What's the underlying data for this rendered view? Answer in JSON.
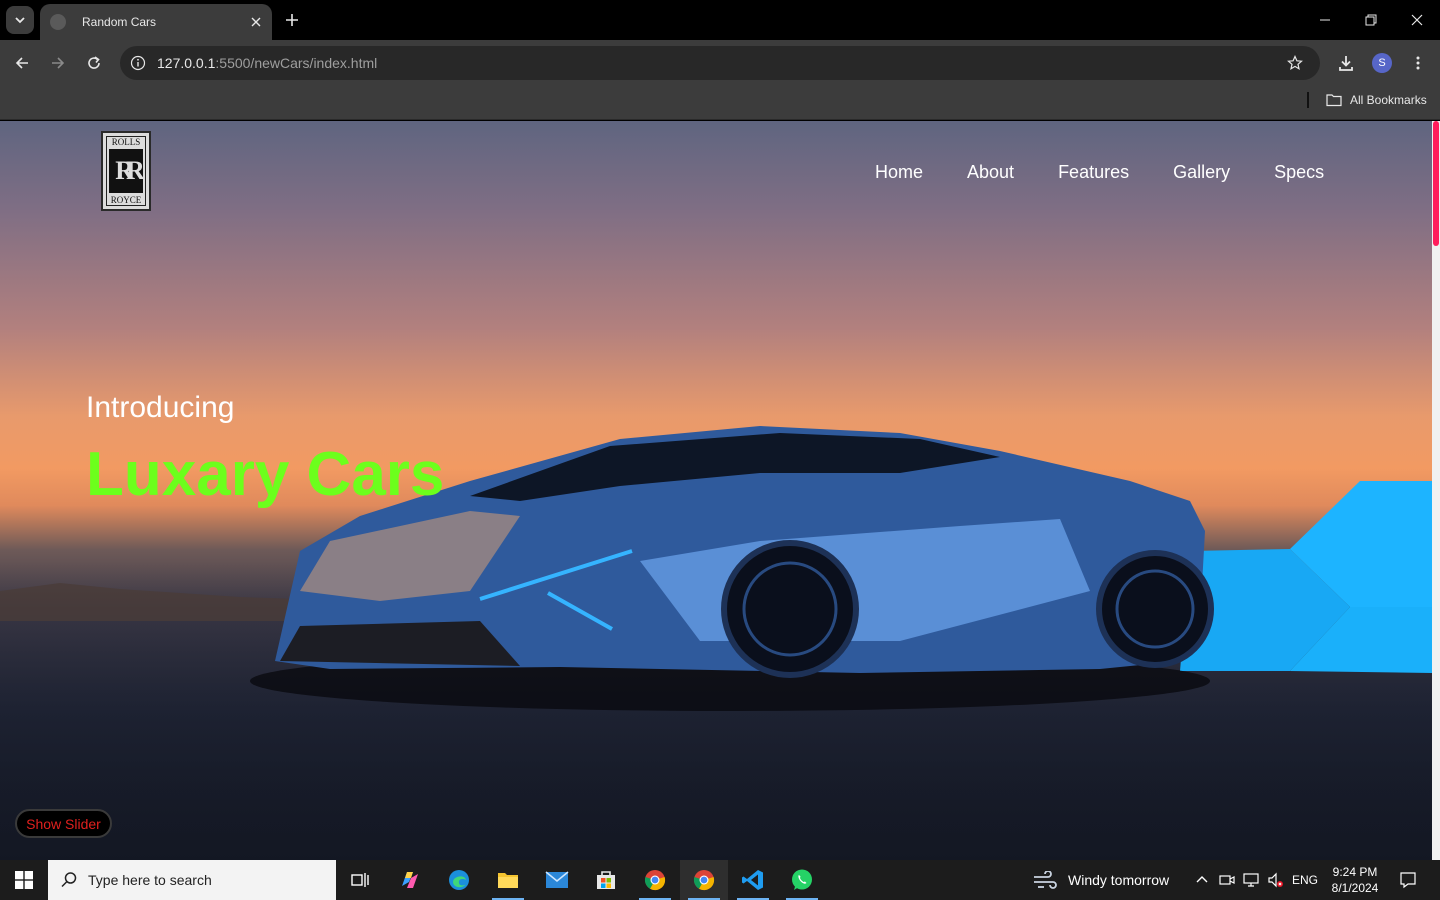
{
  "browser": {
    "tab_title": "Random Cars",
    "url_host": "127.0.0.1",
    "url_path": ":5500/newCars/index.html",
    "bookmarks_label": "All Bookmarks",
    "profile_initial": "S"
  },
  "page": {
    "logo": {
      "top": "ROLLS",
      "monogram": "RR",
      "bottom": "ROYCE"
    },
    "nav": [
      "Home",
      "About",
      "Features",
      "Gallery",
      "Specs"
    ],
    "intro": "Introducing",
    "headline": "Luxary Cars",
    "show_slider_label": "Show Slider",
    "accent_color": "#6cff1c",
    "button_text_color": "#e0201e",
    "scroll_thumb_color": "#ff1d5c"
  },
  "taskbar": {
    "search_placeholder": "Type here to search",
    "weather": "Windy tomorrow",
    "language": "ENG",
    "time": "9:24 PM",
    "date": "8/1/2024",
    "apps": [
      "task-view",
      "copilot",
      "edge",
      "file-explorer",
      "mail",
      "store",
      "chrome",
      "chrome",
      "vscode",
      "whatsapp"
    ]
  }
}
